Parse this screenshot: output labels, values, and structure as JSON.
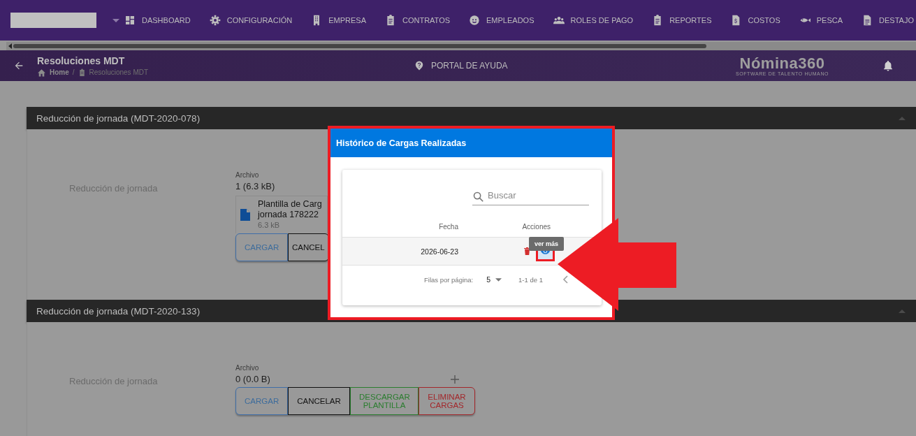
{
  "nav": {
    "items": [
      {
        "label": "DASHBOARD",
        "kind": "dashboard"
      },
      {
        "label": "CONFIGURACIÓN",
        "kind": "gear"
      },
      {
        "label": "EMPRESA",
        "kind": "building"
      },
      {
        "label": "CONTRATOS",
        "kind": "clipboard"
      },
      {
        "label": "EMPLEADOS",
        "kind": "face"
      },
      {
        "label": "ROLES DE PAGO",
        "kind": "people"
      },
      {
        "label": "REPORTES",
        "kind": "clipboard"
      },
      {
        "label": "COSTOS",
        "kind": "invoice"
      },
      {
        "label": "PESCA",
        "kind": "fish"
      },
      {
        "label": "DESTAJO",
        "kind": "document"
      }
    ]
  },
  "header": {
    "title": "Resoluciones MDT",
    "breadcrumb": [
      "Home",
      "Resoluciones MDT"
    ],
    "breadcrumb_separator": "/",
    "help": "PORTAL DE AYUDA",
    "brand": "Nómina360",
    "brand_tagline": "SOFTWARE DE TALENTO HUMANO"
  },
  "panels": [
    {
      "title": "Reducción de jornada (MDT-2020-078)",
      "label": "Reducción de jornada",
      "file_label": "Archivo",
      "file_summary": "1 (6.3 kB)",
      "files": [
        {
          "name_lines": [
            "Plantilla de Carg",
            "jornada 178222"
          ],
          "size": "6.3 kB"
        }
      ],
      "buttons": [
        {
          "label": "CARGAR",
          "kind": "primary"
        },
        {
          "label": "CANCEL",
          "kind": "neutral"
        }
      ]
    },
    {
      "title": "Reducción de jornada (MDT-2020-133)",
      "label": "Reducción de jornada",
      "file_label": "Archivo",
      "file_summary": "0 (0.0 B)",
      "add_button": true,
      "buttons": [
        {
          "label": "CARGAR",
          "kind": "primary"
        },
        {
          "label": "CANCELAR",
          "kind": "neutral"
        },
        {
          "label": "DESCARGAR PLANTILLA",
          "kind": "success"
        },
        {
          "label": "ELIMINAR CARGAS",
          "kind": "danger"
        }
      ]
    }
  ],
  "dialog": {
    "title": "Histórico de Cargas Realizadas",
    "search": {
      "placeholder": "Buscar"
    },
    "columns": [
      "Fecha",
      "Acciones"
    ],
    "rows": [
      {
        "date": "2026-06-23"
      }
    ],
    "tooltip": "ver más",
    "footer": {
      "rows_per_page_label": "Filas por página:",
      "rows_per_page": "5",
      "range": "1-1 de 1"
    }
  }
}
